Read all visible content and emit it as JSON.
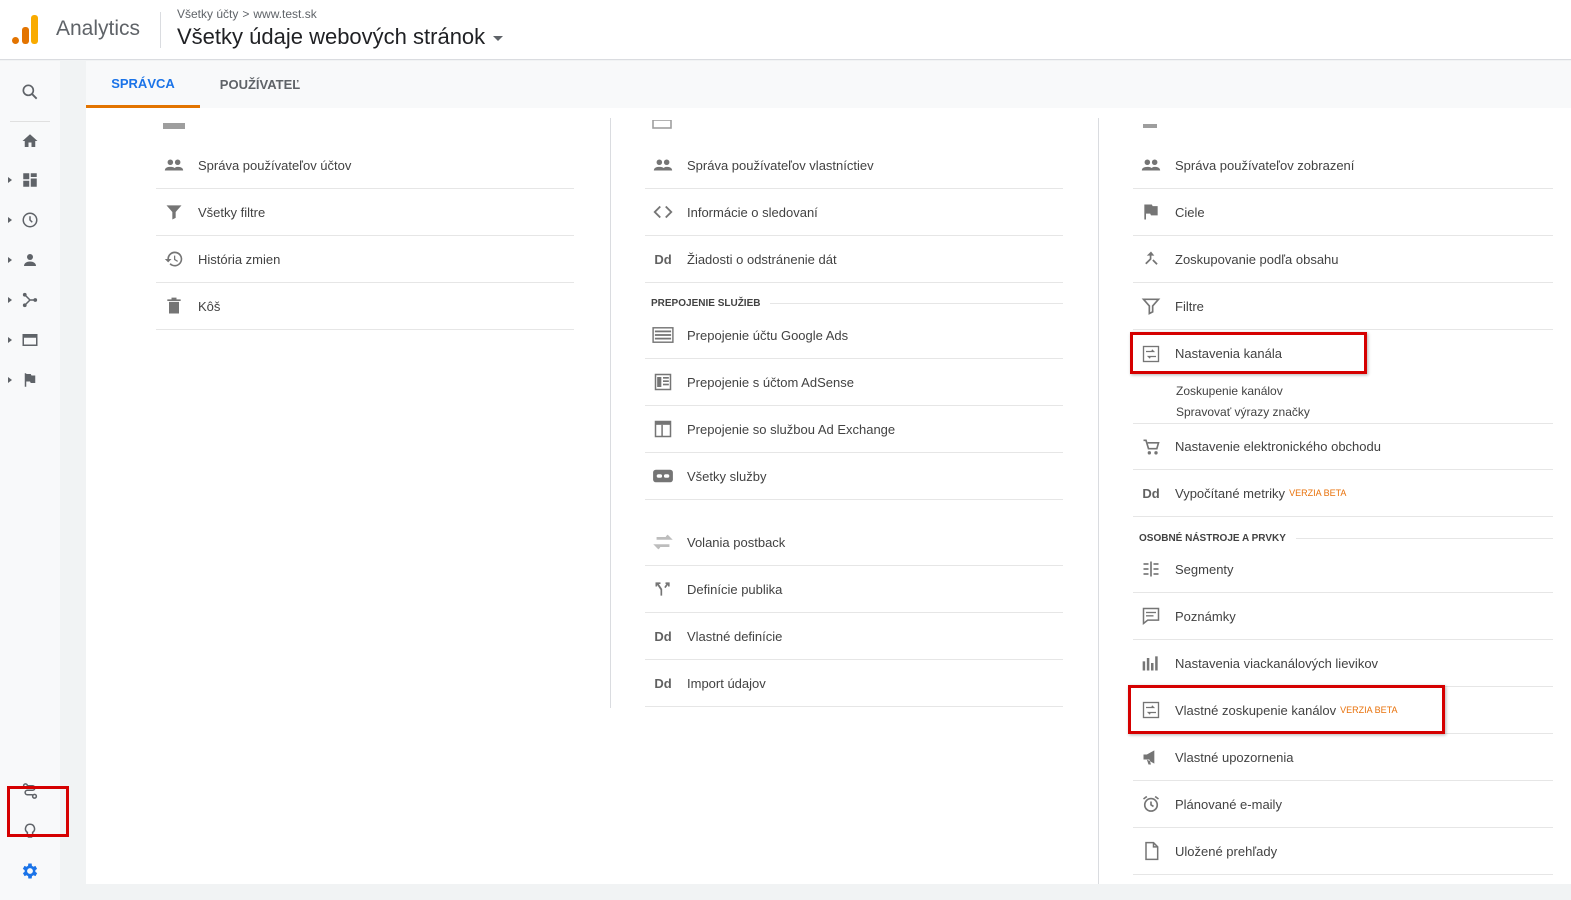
{
  "header": {
    "brand": "Analytics",
    "breadcrumb_account": "Všetky účty",
    "breadcrumb_arrow": ">",
    "breadcrumb_property": "www.test.sk",
    "view_name": "Všetky údaje webových stránok"
  },
  "tabs": {
    "admin": "SPRÁVCA",
    "user": "POUŽÍVATEĽ"
  },
  "account_column": {
    "items": [
      "Správa používateľov účtov",
      "Všetky filtre",
      "História zmien",
      "Kôš"
    ]
  },
  "property_column": {
    "items": [
      "Správa používateľov vlastníctiev",
      "Informácie o sledovaní",
      "Žiadosti o odstránenie dát"
    ],
    "linking_header": "PREPOJENIE SLUŽIEB",
    "linking": [
      "Prepojenie účtu Google Ads",
      "Prepojenie s účtom AdSense",
      "Prepojenie so službou Ad Exchange",
      "Všetky služby"
    ],
    "more": [
      "Volania postback",
      "Definície publika",
      "Vlastné definície",
      "Import údajov"
    ]
  },
  "view_column": {
    "items": [
      "Správa používateľov zobrazení",
      "Ciele",
      "Zoskupovanie podľa obsahu",
      "Filtre",
      "Nastavenia kanála"
    ],
    "channel_sub": [
      "Zoskupenie kanálov",
      "Spravovať výrazy značky"
    ],
    "ecommerce": "Nastavenie elektronického obchodu",
    "calc_metrics": "Vypočítané metriky",
    "beta_label": "VERZIA BETA",
    "personal_header": "OSOBNÉ NÁSTROJE A PRVKY",
    "personal": [
      "Segmenty",
      "Poznámky",
      "Nastavenia viackanálových lievikov",
      "Vlastné zoskupenie kanálov",
      "Vlastné upozornenia",
      "Plánované e-maily",
      "Uložené prehľady"
    ]
  },
  "icons": {
    "dd": "Dd"
  },
  "colors": {
    "accent_blue": "#1a73e8",
    "accent_orange": "#e37400",
    "highlight_red": "#d50000"
  }
}
